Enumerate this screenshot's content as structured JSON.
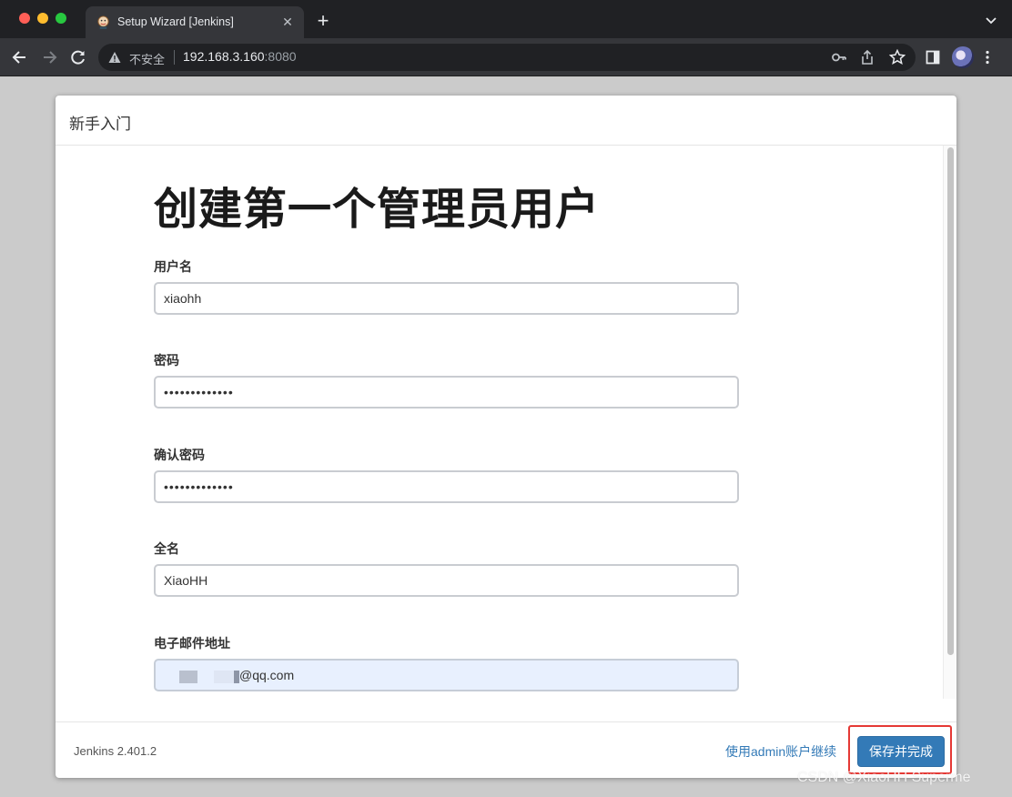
{
  "browser": {
    "tab": {
      "title": "Setup Wizard [Jenkins]",
      "close_icon": "close-icon",
      "favicon": "jenkins-icon"
    },
    "new_tab_label": "+",
    "omnibox": {
      "security_label": "不安全",
      "host": "192.168.3.160",
      "port": ":8080"
    }
  },
  "dialog": {
    "title": "新手入门",
    "heading": "创建第一个管理员用户",
    "fields": {
      "username": {
        "label": "用户名",
        "value": "xiaohh"
      },
      "password": {
        "label": "密码",
        "value": "•••••••••••••"
      },
      "confirm_password": {
        "label": "确认密码",
        "value": "•••••••••••••"
      },
      "full_name": {
        "label": "全名",
        "value": "XiaoHH"
      },
      "email": {
        "label": "电子邮件地址",
        "value": "@qq.com"
      }
    },
    "footer": {
      "version": "Jenkins 2.401.2",
      "continue_link": "使用admin账户继续",
      "save_button": "保存并完成"
    }
  },
  "watermark": "CSDN @XiaoHH Superme",
  "colors": {
    "primary": "#337ab7",
    "highlight": "#e53935",
    "autofill": "#e8f0fe"
  }
}
